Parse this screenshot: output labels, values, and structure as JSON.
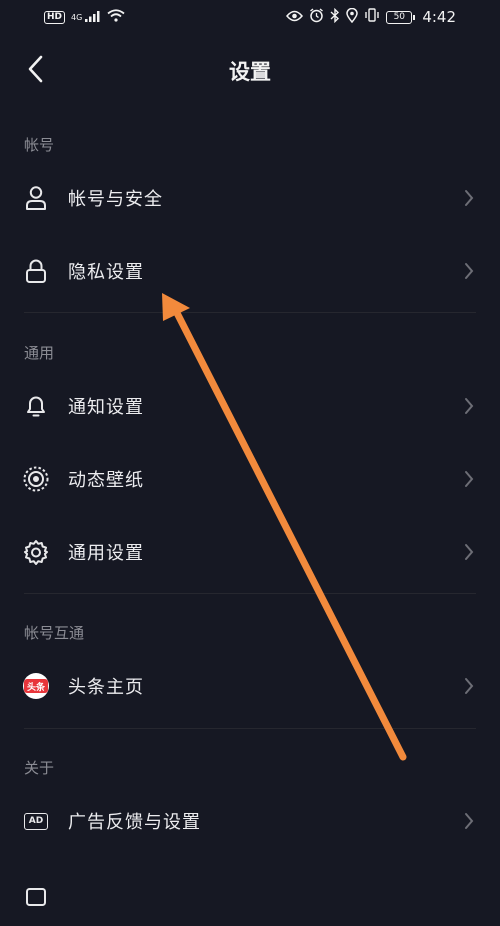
{
  "status_bar": {
    "hd": "HD",
    "network": "4G",
    "battery": "50",
    "time": "4:42"
  },
  "nav": {
    "title": "设置"
  },
  "sections": {
    "account": {
      "title": "帐号",
      "items": [
        {
          "label": "帐号与安全",
          "icon": "user-icon"
        },
        {
          "label": "隐私设置",
          "icon": "lock-icon"
        }
      ]
    },
    "general": {
      "title": "通用",
      "items": [
        {
          "label": "通知设置",
          "icon": "bell-icon"
        },
        {
          "label": "动态壁纸",
          "icon": "live-wallpaper-icon"
        },
        {
          "label": "通用设置",
          "icon": "gear-icon"
        }
      ]
    },
    "linked": {
      "title": "帐号互通",
      "items": [
        {
          "label": "头条主页",
          "icon": "toutiao-icon",
          "badge_text": "头条"
        }
      ]
    },
    "about": {
      "title": "关于",
      "items": [
        {
          "label": "广告反馈与设置",
          "icon": "ad-icon",
          "badge_text": "AD"
        }
      ]
    }
  },
  "colors": {
    "background": "#161823",
    "text": "#ececef",
    "section_title": "#8b8c94",
    "annotation_arrow": "#f28a3c",
    "toutiao_red": "#e8353b"
  }
}
